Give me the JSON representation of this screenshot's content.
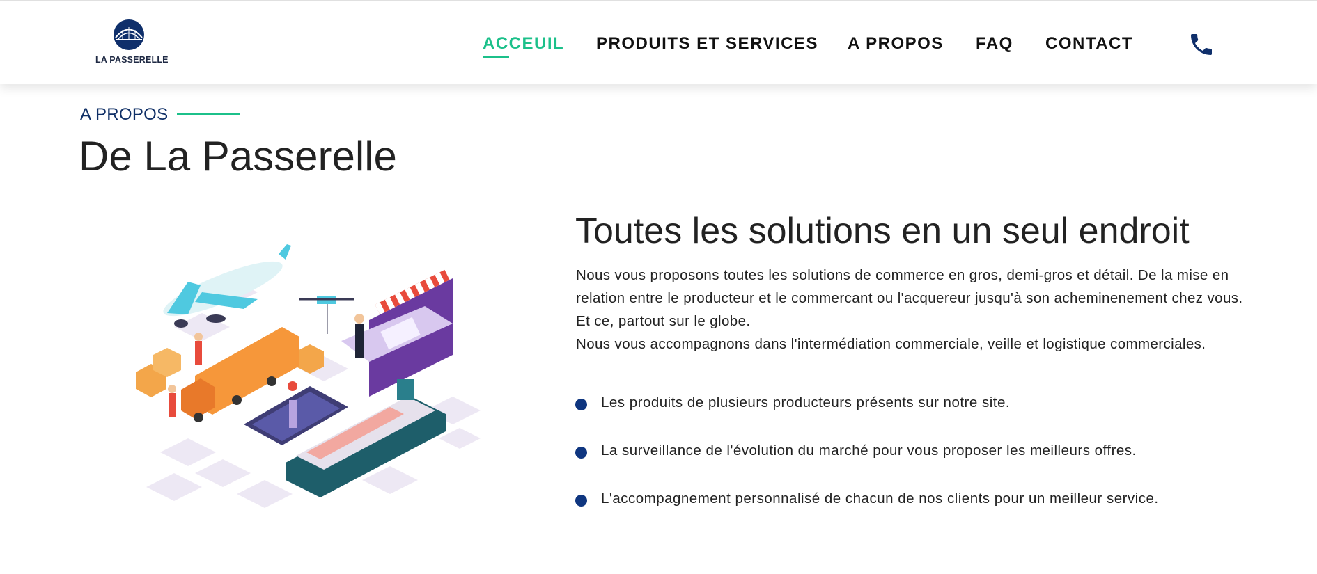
{
  "brand": {
    "name": "LA PASSERELLE"
  },
  "nav": {
    "items": [
      {
        "label": "ACCEUIL",
        "active": true
      },
      {
        "label": "PRODUITS ET SERVICES",
        "active": false
      },
      {
        "label": "A PROPOS",
        "active": false
      },
      {
        "label": "FAQ",
        "active": false
      },
      {
        "label": "CONTACT",
        "active": false
      }
    ],
    "phone_icon": "phone-icon"
  },
  "section": {
    "kicker": "A PROPOS",
    "title": "De La Passerelle"
  },
  "content": {
    "title": "Toutes les solutions en un seul endroit",
    "paragraph1": "Nous vous proposons toutes les solutions de commerce en gros, demi-gros et détail. De la mise en relation entre le producteur et le commercant ou l'acquereur jusqu'à son acheminenement chez vous. Et ce, partout sur le globe.",
    "paragraph2": "Nous vous accompagnons dans l'intermédiation commerciale, veille et logistique commerciales.",
    "features": [
      "Les produits de plusieurs producteurs présents sur notre site.",
      "La surveillance de l'évolution du marché pour vous proposer les meilleurs offres.",
      "L'accompagnement personnalisé de chacun de nos clients pour un meilleur service."
    ]
  },
  "colors": {
    "accent": "#1cc08a",
    "navy": "#0f3680",
    "text": "#222222"
  }
}
